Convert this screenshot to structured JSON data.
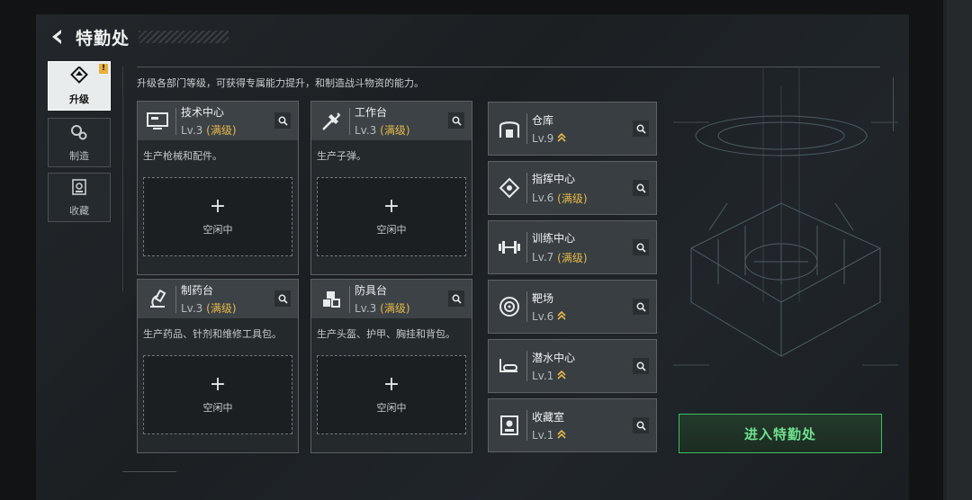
{
  "header": {
    "title": "特勤处",
    "back_icon": "back-arrow-icon"
  },
  "sidebar": {
    "items": [
      {
        "label": "升级",
        "icon": "upgrade-icon",
        "active": true,
        "badge": "!"
      },
      {
        "label": "制造",
        "icon": "craft-icon",
        "active": false
      },
      {
        "label": "收藏",
        "icon": "collection-icon",
        "active": false
      }
    ]
  },
  "description": "升级各部门等级，可获得专属能力提升，和制造战斗物资的能力。",
  "workbenches": [
    {
      "name": "技术中心",
      "level": "Lv.3",
      "status": "(满级)",
      "desc": "生产枪械和配件。",
      "slot_status": "空闲中",
      "icon": "tech-center-icon"
    },
    {
      "name": "工作台",
      "level": "Lv.3",
      "status": "(满级)",
      "desc": "生产子弹。",
      "slot_status": "空闲中",
      "icon": "workbench-icon"
    },
    {
      "name": "制药台",
      "level": "Lv.3",
      "status": "(满级)",
      "desc": "生产药品、针剂和维修工具包。",
      "slot_status": "空闲中",
      "icon": "pharmacy-icon"
    },
    {
      "name": "防具台",
      "level": "Lv.3",
      "status": "(满级)",
      "desc": "生产头盔、护甲、胸挂和背包。",
      "slot_status": "空闲中",
      "icon": "armor-bench-icon"
    }
  ],
  "facilities": [
    {
      "name": "仓库",
      "level": "Lv.9",
      "status": "",
      "upgradable": true,
      "icon": "warehouse-icon"
    },
    {
      "name": "指挥中心",
      "level": "Lv.6",
      "status": "(满级)",
      "upgradable": false,
      "icon": "command-center-icon"
    },
    {
      "name": "训练中心",
      "level": "Lv.7",
      "status": "(满级)",
      "upgradable": false,
      "icon": "training-center-icon"
    },
    {
      "name": "靶场",
      "level": "Lv.6",
      "status": "",
      "upgradable": true,
      "icon": "shooting-range-icon"
    },
    {
      "name": "潜水中心",
      "level": "Lv.1",
      "status": "",
      "upgradable": true,
      "icon": "diving-center-icon"
    },
    {
      "name": "收藏室",
      "level": "Lv.1",
      "status": "",
      "upgradable": true,
      "icon": "collection-room-icon"
    }
  ],
  "enter_button": "进入特勤处",
  "colors": {
    "accent_gold": "#e5b84a",
    "accent_green": "#3fbf66",
    "panel": "#24292c"
  }
}
